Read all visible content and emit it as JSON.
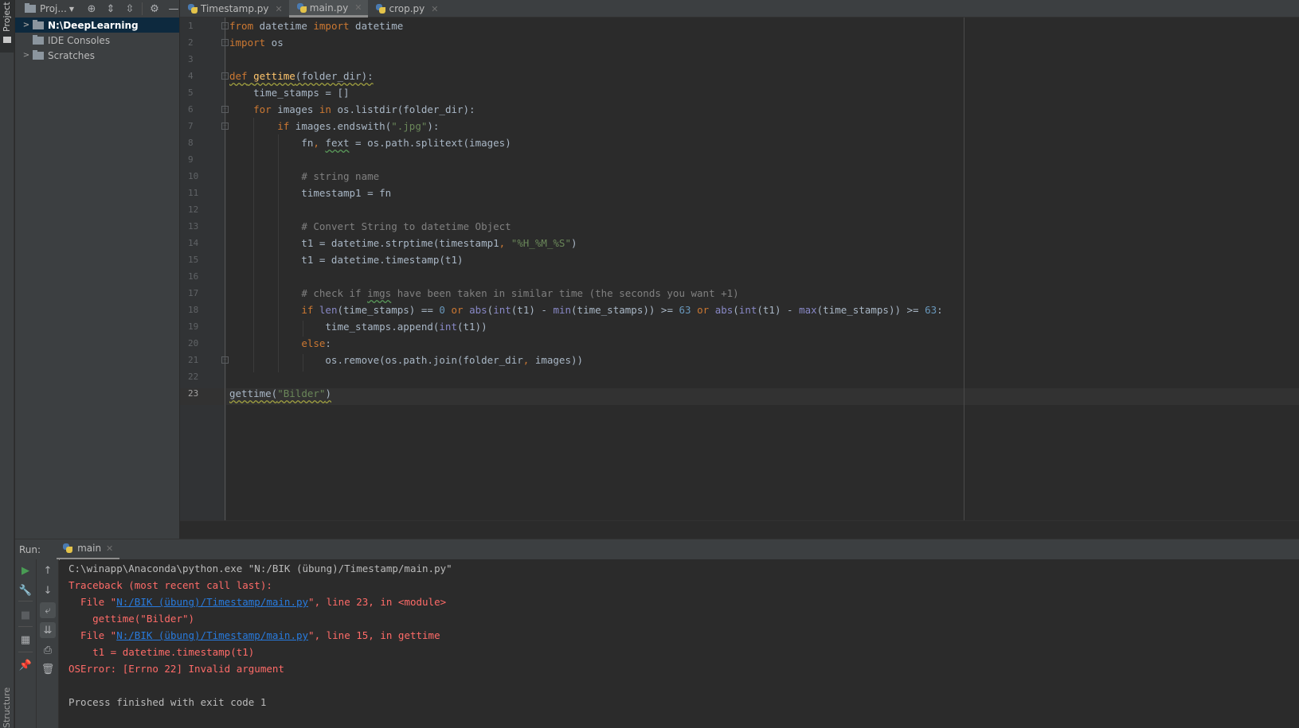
{
  "tool_strip": {
    "project_label": "Project",
    "structure_label": "Structure"
  },
  "project_panel": {
    "title": "Proj...",
    "header_icons": [
      "locate-icon",
      "expand-all-icon",
      "collapse-all-icon",
      "gear-icon",
      "minimize-icon"
    ],
    "tree": [
      {
        "label": "N:\\DeepLearning",
        "expandable": true,
        "selected": true
      },
      {
        "label": "IDE Consoles",
        "expandable": false,
        "selected": false
      },
      {
        "label": "Scratches",
        "expandable": true,
        "selected": false
      }
    ]
  },
  "editor": {
    "tabs": [
      {
        "label": "Timestamp.py",
        "active": false
      },
      {
        "label": "main.py",
        "active": true
      },
      {
        "label": "crop.py",
        "active": false
      }
    ],
    "current_line": 23,
    "lines": [
      {
        "n": "1",
        "text": "from datetime import datetime"
      },
      {
        "n": "2",
        "text": "import os"
      },
      {
        "n": "3",
        "text": ""
      },
      {
        "n": "4",
        "text": "def gettime(folder_dir):"
      },
      {
        "n": "5",
        "text": "    time_stamps = []"
      },
      {
        "n": "6",
        "text": "    for images in os.listdir(folder_dir):"
      },
      {
        "n": "7",
        "text": "        if images.endswith(\".jpg\"):"
      },
      {
        "n": "8",
        "text": "            fn, fext = os.path.splitext(images)"
      },
      {
        "n": "9",
        "text": ""
      },
      {
        "n": "10",
        "text": "            # string name"
      },
      {
        "n": "11",
        "text": "            timestamp1 = fn"
      },
      {
        "n": "12",
        "text": ""
      },
      {
        "n": "13",
        "text": "            # Convert String to datetime Object"
      },
      {
        "n": "14",
        "text": "            t1 = datetime.strptime(timestamp1, \"%H_%M_%S\")"
      },
      {
        "n": "15",
        "text": "            t1 = datetime.timestamp(t1)"
      },
      {
        "n": "16",
        "text": ""
      },
      {
        "n": "17",
        "text": "            # check if imgs have been taken in similar time (the seconds you want +1)"
      },
      {
        "n": "18",
        "text": "            if len(time_stamps) == 0 or abs(int(t1) - min(time_stamps)) >= 63 or abs(int(t1) - max(time_stamps)) >= 63:"
      },
      {
        "n": "19",
        "text": "                time_stamps.append(int(t1))"
      },
      {
        "n": "20",
        "text": "            else:"
      },
      {
        "n": "21",
        "text": "                os.remove(os.path.join(folder_dir, images))"
      },
      {
        "n": "22",
        "text": ""
      },
      {
        "n": "23",
        "text": "gettime(\"Bilder\")"
      }
    ]
  },
  "run_panel": {
    "label": "Run:",
    "tab_label": "main",
    "toolbar_left": [
      "run-icon",
      "wrench-icon",
      "stop-icon",
      "layout-icon",
      "pin-icon"
    ],
    "toolbar_right": [
      "up-arrow-icon",
      "down-arrow-icon",
      "soft-wrap-icon",
      "scroll-to-end-icon",
      "print-icon",
      "trash-icon"
    ],
    "console": {
      "command": "C:\\winapp\\Anaconda\\python.exe \"N:/BIK (übung)/Timestamp/main.py\"",
      "traceback_header": "Traceback (most recent call last):",
      "frames": [
        {
          "prefix": "  File \"",
          "path": "N:/BIK (übung)/Timestamp/main.py",
          "suffix": "\", line 23, in <module>",
          "code": "    gettime(\"Bilder\")"
        },
        {
          "prefix": "  File \"",
          "path": "N:/BIK (übung)/Timestamp/main.py",
          "suffix": "\", line 15, in gettime",
          "code": "    t1 = datetime.timestamp(t1)"
        }
      ],
      "error": "OSError: [Errno 22] Invalid argument",
      "exit_message": "Process finished with exit code 1"
    }
  },
  "colors": {
    "keyword": "#cc7832",
    "function": "#ffc66d",
    "string": "#6a8759",
    "comment": "#808080",
    "builtin": "#8888c6",
    "number": "#6897bb",
    "error": "#ff6b68",
    "link": "#287bde",
    "selection": "#0d293e"
  }
}
